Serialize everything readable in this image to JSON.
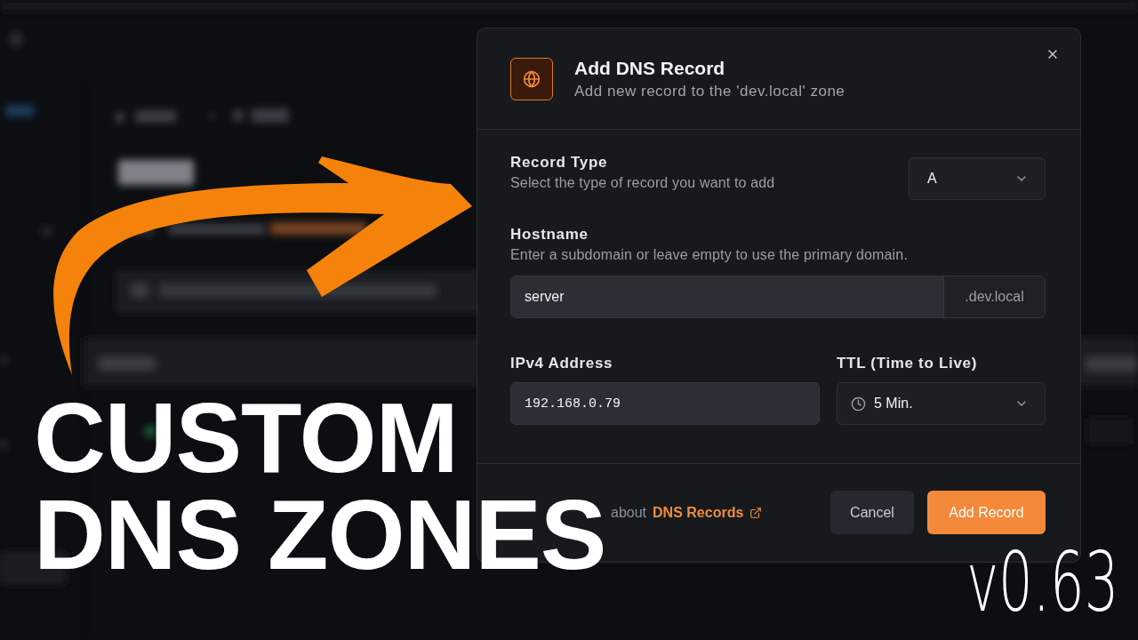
{
  "dialog": {
    "title": "Add DNS Record",
    "subtitle": "Add new record to the 'dev.local' zone",
    "record_type": {
      "label": "Record Type",
      "description": "Select the type of record you want to add",
      "value": "A"
    },
    "hostname": {
      "label": "Hostname",
      "description": "Enter a subdomain or leave empty to use the primary domain.",
      "value": "server",
      "suffix": ".dev.local"
    },
    "ipv4": {
      "label": "IPv4 Address",
      "value": "192.168.0.79"
    },
    "ttl": {
      "label": "TTL (Time to Live)",
      "value": "5 Min."
    },
    "footer": {
      "text": "about",
      "link": "DNS Records"
    },
    "buttons": [
      {
        "label": "Cancel",
        "kind": "secondary"
      },
      {
        "label": "Add Record",
        "kind": "primary"
      }
    ]
  },
  "overlay": {
    "headline": [
      "CUSTOM",
      "DNS ZONES"
    ],
    "version": "v0.63"
  }
}
